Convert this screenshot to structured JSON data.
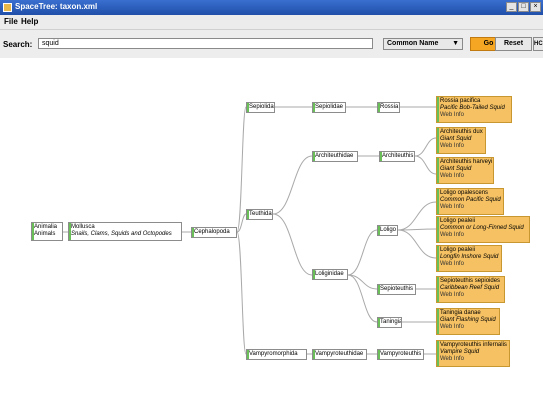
{
  "window": {
    "title": "SpaceTree: taxon.xml"
  },
  "menu": {
    "file": "File",
    "help": "Help"
  },
  "toolbar": {
    "search_label": "Search:",
    "search_value": "squid",
    "select_value": "Common Name",
    "go_label": "Go",
    "reset_label": "Reset",
    "hc_label": "HC"
  },
  "tree": {
    "animalia": {
      "line1": "Animalia",
      "line2": "Animals"
    },
    "mollusca": {
      "line1": "Mollusca",
      "line2": "Snails, Clams, Squids and Octopodes"
    },
    "cephalopoda": "Cephalopoda",
    "sepiolida": "Sepiolida",
    "sepiolidae": "Sepiolidae",
    "rossia": "Rossia",
    "teuthida": "Teuthida",
    "architeuthidae": "Architeuthidae",
    "architeuthis": "Architeuthis",
    "loliginidae": "Loliginidae",
    "loligo": "Loligo",
    "sepioteuthis": "Sepioteuthis",
    "taningia": "Taningia",
    "vampyromorphida": "Vampyromorphida",
    "vampyroteuthidae": "Vampyroteuthidae",
    "vampyroteuthis": "Vampyroteuthis"
  },
  "leaves": [
    {
      "sci": "Rossia pacifica",
      "common": "Pacific Bob-Tailed Squid",
      "web": "Web Info"
    },
    {
      "sci": "Architeuthis dux",
      "common": "Giant Squid",
      "web": "Web Info"
    },
    {
      "sci": "Architeuthis harveyi",
      "common": "Giant Squid",
      "web": "Web Info"
    },
    {
      "sci": "Loligo opalescens",
      "common": "Common Pacific Squid",
      "web": "Web Info"
    },
    {
      "sci": "Loligo pealeii",
      "common": "Common or Long-Finned Squid",
      "web": "Web Info"
    },
    {
      "sci": "Loligo pealeii",
      "common": "Longfin Inshore Squid",
      "web": "Web Info"
    },
    {
      "sci": "Sepioteuthis sepioides",
      "common": "Caribbean Reef Squid",
      "web": "Web Info"
    },
    {
      "sci": "Taningia danae",
      "common": "Giant Flashing Squid",
      "web": "Web Info"
    },
    {
      "sci": "Vampyroteuthis infernalis",
      "common": "Vampire Squid",
      "web": "Web Info"
    }
  ],
  "colors": {
    "leaf_fill": "#f5c163",
    "accent_green": "#6bbf59",
    "go_button": "#f5a623"
  }
}
